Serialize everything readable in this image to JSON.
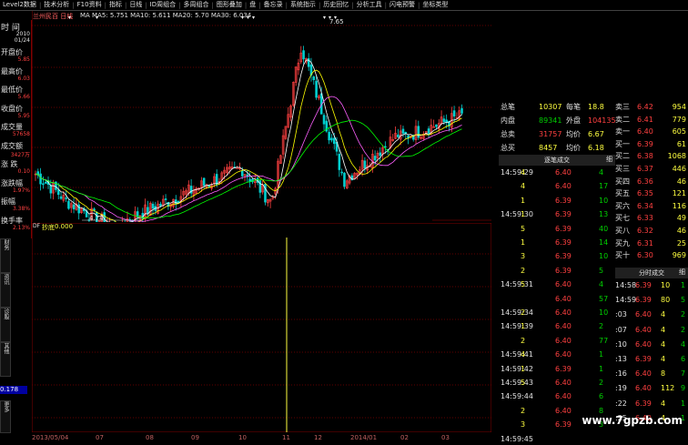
{
  "menu": [
    "Level2数据",
    "技术分析",
    "F10资料",
    "指标",
    "日线",
    "ID周组合",
    "多周组合",
    "图形叠加",
    "盘",
    "备忘录",
    "系统指示",
    "历史回忆",
    "分析工具",
    "闪电预警",
    "坐标类型"
  ],
  "chart_header": {
    "title": "兰州民百 日线",
    "ma_text": "MA MA5: 5.751  MA10: 5.611  MA20: 5.70  MA30: 6.034",
    "high_label": "7.65",
    "low_label": "4.74"
  },
  "left_info": {
    "top_label": "时 间",
    "date_top": "2010",
    "date_bot": "01/24",
    "items": [
      {
        "label": "开盘价",
        "value": "5.85"
      },
      {
        "label": "最高价",
        "value": "6.03"
      },
      {
        "label": "最低价",
        "value": "5.66"
      },
      {
        "label": "收盘价",
        "value": "5.95"
      },
      {
        "label": "成交量",
        "value": "57658"
      },
      {
        "label": "成交额",
        "value": "3427万"
      },
      {
        "label": "涨 跌",
        "value": "0.10"
      },
      {
        "label": "涨跌幅",
        "value": "1.97%"
      },
      {
        "label": "振幅",
        "value": "3.38%"
      },
      {
        "label": "换手率",
        "value": "2.13%"
      }
    ]
  },
  "sub_chart": {
    "label": "抄底",
    "value": "0.000",
    "prefix": "DF",
    "left_value": "0.178"
  },
  "x_axis": {
    "labels": [
      "2013/05/04",
      "07",
      "08",
      "09",
      "10",
      "11",
      "12",
      "2014/01",
      "02",
      "03"
    ]
  },
  "summary": [
    {
      "l1": "总笔",
      "v1": "10307",
      "l2": "每笔",
      "v2": "18.8"
    },
    {
      "l1": "内盘",
      "v1": "89341",
      "l2": "外盘",
      "v2": "104135"
    },
    {
      "l1": "总卖",
      "v1": "31757",
      "l2": "均价",
      "v2": "6.67"
    },
    {
      "l1": "总买",
      "v1": "8457",
      "l2": "均价",
      "v2": "6.18"
    }
  ],
  "order_book": [
    {
      "label": "卖三",
      "price": "6.42",
      "vol": "954"
    },
    {
      "label": "卖二",
      "price": "6.41",
      "vol": "779"
    },
    {
      "label": "卖一",
      "price": "6.40",
      "vol": "605"
    },
    {
      "label": "买一",
      "price": "6.39",
      "vol": "61"
    },
    {
      "label": "买二",
      "price": "6.38",
      "vol": "1068"
    },
    {
      "label": "买三",
      "price": "6.37",
      "vol": "446"
    },
    {
      "label": "买四",
      "price": "6.36",
      "vol": "46"
    },
    {
      "label": "买五",
      "price": "6.35",
      "vol": "121"
    },
    {
      "label": "买六",
      "price": "6.34",
      "vol": "116"
    },
    {
      "label": "买七",
      "price": "6.33",
      "vol": "49"
    },
    {
      "label": "买八",
      "price": "6.32",
      "vol": "46"
    },
    {
      "label": "买九",
      "price": "6.31",
      "vol": "25"
    },
    {
      "label": "买十",
      "price": "6.30",
      "vol": "969"
    }
  ],
  "tick_header": "逐笔成交",
  "tick_header_btn": "细",
  "ticks": [
    {
      "time": "14:59:29",
      "price": "6.40",
      "vol": "4"
    },
    {
      "time": "",
      "price": "6.40",
      "vol": "17"
    },
    {
      "time": "",
      "price": "6.39",
      "vol": "10"
    },
    {
      "time": "14:59:30",
      "price": "6.39",
      "vol": "13"
    },
    {
      "time": "",
      "price": "6.39",
      "vol": "40"
    },
    {
      "time": "",
      "price": "6.39",
      "vol": "14"
    },
    {
      "time": "",
      "price": "6.39",
      "vol": "10"
    },
    {
      "time": "",
      "price": "6.39",
      "vol": "5"
    },
    {
      "time": "14:59:31",
      "price": "6.40",
      "vol": "4"
    },
    {
      "time": "",
      "price": "6.40",
      "vol": "57"
    },
    {
      "time": "14:59:34",
      "price": "6.40",
      "vol": "10"
    },
    {
      "time": "14:59:39",
      "price": "6.40",
      "vol": "2"
    },
    {
      "time": "",
      "price": "6.40",
      "vol": "77"
    },
    {
      "time": "14:59:41",
      "price": "6.40",
      "vol": "1"
    },
    {
      "time": "14:59:42",
      "price": "6.39",
      "vol": "1"
    },
    {
      "time": "14:59:43",
      "price": "6.40",
      "vol": "2"
    },
    {
      "time": "14:59:44",
      "price": "6.40",
      "vol": "6"
    },
    {
      "time": "",
      "price": "6.40",
      "vol": "8"
    },
    {
      "time": "",
      "price": "6.39",
      "vol": "3"
    },
    {
      "time": "14:59:45",
      "price": "",
      "vol": ""
    }
  ],
  "tick_numbers": [
    "4",
    "4",
    "1",
    "1",
    "5",
    "1",
    "3",
    "2",
    "5",
    "",
    "2",
    "1",
    "2",
    "4",
    "1",
    "5",
    "",
    "2",
    "3",
    ""
  ],
  "time_header": "分时成交",
  "time_header_btn": "细",
  "time_ticks": [
    {
      "time": "14:58",
      "price": "6.39",
      "vol": "10",
      "n": "1"
    },
    {
      "time": "14:59",
      "price": "6.39",
      "vol": "80",
      "n": "5"
    },
    {
      "time": ":03",
      "price": "6.40",
      "vol": "4",
      "n": "2"
    },
    {
      "time": ":07",
      "price": "6.40",
      "vol": "4",
      "n": "2"
    },
    {
      "time": ":10",
      "price": "6.40",
      "vol": "4",
      "n": "4"
    },
    {
      "time": ":13",
      "price": "6.39",
      "vol": "4",
      "n": "6"
    },
    {
      "time": ":16",
      "price": "6.40",
      "vol": "8",
      "n": "7"
    },
    {
      "time": ":19",
      "price": "6.40",
      "vol": "112",
      "n": "9"
    },
    {
      "time": ":22",
      "price": "6.39",
      "vol": "4",
      "n": "1"
    },
    {
      "time": ":25",
      "price": "6.40",
      "vol": "4",
      "n": "1"
    }
  ],
  "watermark": "www.7gpzb.com",
  "colors": {
    "up": "#ff4040",
    "down": "#00d0d0",
    "ma5": "#ffffff",
    "ma10": "#ffff00",
    "ma20": "#ff60ff",
    "ma30": "#00ff00"
  }
}
